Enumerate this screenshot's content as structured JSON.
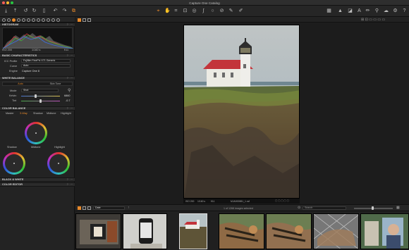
{
  "window": {
    "title": "Capture One Catalog"
  },
  "toolbar": {
    "left_icons": [
      "import-icon",
      "export-icon",
      "rotate-left-icon",
      "rotate-right-icon",
      "delete-icon",
      "undo-icon",
      "redo-icon",
      "compare-icon"
    ],
    "center_icons": [
      "pointer-icon",
      "pan-icon",
      "crop-icon",
      "keystone-icon",
      "spot-icon",
      "gradient-icon",
      "circle-mask-icon",
      "erase-icon",
      "brush-icon"
    ],
    "right_icons": [
      "grid-icon",
      "exposure-warning-icon",
      "focus-icon",
      "text-icon",
      "brush-tool-icon",
      "eyedropper-icon",
      "cloud-icon",
      "settings-icon"
    ]
  },
  "left_panel": {
    "histogram": {
      "title": "HISTOGRAM",
      "iso": "ISO 200",
      "shutter": "1/160 s",
      "aperture": "f/11"
    },
    "basic": {
      "title": "BASIC CHARACTERISTICS",
      "icc_label": "ICC Profile",
      "icc_value": "Fujifilm FinePix X71 Generic",
      "curve_label": "Curve",
      "curve_value": "Auto",
      "engine_label": "Engine",
      "engine_value": "Capture One 8"
    },
    "white_balance": {
      "title": "WHITE BALANCE",
      "tab_auto": "Auto",
      "tab_skin": "Skin Tone",
      "mode_label": "Mode",
      "mode_value": "Shot",
      "kelvin_label": "Kelvin",
      "kelvin_value": "6860",
      "tint_label": "Tint",
      "tint_value": "-0.7"
    },
    "color_balance": {
      "title": "COLOR BALANCE",
      "tabs": [
        "Master",
        "3-Way",
        "Shadow",
        "Midtone",
        "Highlight"
      ],
      "midtone_label": "Midtone",
      "shadow_label": "Shadow",
      "highlight_label": "Highlight"
    },
    "bw": {
      "title": "BLACK & WHITE"
    },
    "color_editor": {
      "title": "COLOR EDITOR"
    }
  },
  "viewer": {
    "photo_iso": "ISO 200",
    "photo_shutter": "1/160 s",
    "photo_aperture": "f/11",
    "filename": "MJA000881_1.raf"
  },
  "browser": {
    "sort_label": "Date",
    "count": "1 of 1268 images selected",
    "search_placeholder": "Search"
  },
  "colors": {
    "accent": "#e8892a",
    "panel": "#232323",
    "background": "#1b1b1b"
  }
}
